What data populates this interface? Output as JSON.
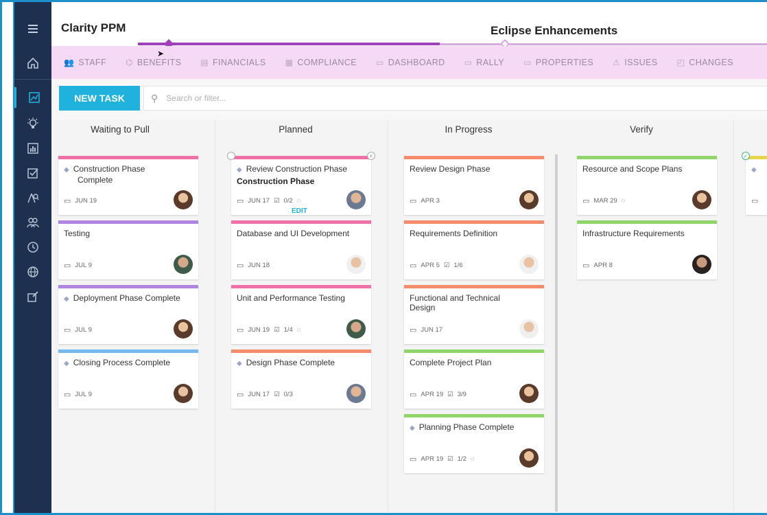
{
  "app": {
    "title": "Clarity PPM",
    "project_title": "Eclipse Enhancements"
  },
  "sidebar": {
    "items": [
      {
        "icon": "menu-icon"
      },
      {
        "icon": "home-icon"
      },
      {
        "icon": "chart-icon"
      },
      {
        "icon": "lightbulb-icon"
      },
      {
        "icon": "bar-chart-icon"
      },
      {
        "icon": "checkbox-icon"
      },
      {
        "icon": "person-search-icon"
      },
      {
        "icon": "users-icon"
      },
      {
        "icon": "clock-icon"
      },
      {
        "icon": "globe-icon"
      },
      {
        "icon": "edit-box-icon"
      }
    ]
  },
  "tabs": [
    {
      "label": "STAFF"
    },
    {
      "label": "BENEFITS"
    },
    {
      "label": "FINANCIALS"
    },
    {
      "label": "COMPLIANCE"
    },
    {
      "label": "DASHBOARD"
    },
    {
      "label": "RALLY"
    },
    {
      "label": "PROPERTIES"
    },
    {
      "label": "ISSUES"
    },
    {
      "label": "CHANGES"
    }
  ],
  "toolbar": {
    "new_task_label": "NEW TASK",
    "search_placeholder": "Search or filter..."
  },
  "columns": [
    {
      "title": "Waiting to Pull",
      "cards": [
        {
          "title": "Construction Phase Complete",
          "date": "JUN 19",
          "milestone": true,
          "stripe": "#f070a8",
          "avatar": "woman"
        },
        {
          "title": "Testing",
          "date": "JUL 9",
          "milestone": false,
          "stripe": "#b085e0",
          "avatar": "man"
        },
        {
          "title": "Deployment Phase Complete",
          "date": "JUL 9",
          "milestone": true,
          "stripe": "#b085e0",
          "avatar": "woman"
        },
        {
          "title": "Closing Process Complete",
          "date": "JUL 9",
          "milestone": true,
          "stripe": "#74b8ee",
          "avatar": "woman"
        }
      ]
    },
    {
      "title": "Planned",
      "cards": [
        {
          "title": "Review Construction Phase",
          "subtitle": "Construction Phase",
          "date": "JUN 17",
          "checks": "0/2",
          "comment": true,
          "edit": "EDIT",
          "milestone": true,
          "stripe": "#f070a8",
          "avatar": "glasses"
        },
        {
          "title": "Database and UI Development",
          "date": "JUN 18",
          "stripe": "#f070a8",
          "avatar": "white"
        },
        {
          "title": "Unit and Performance Testing",
          "date": "JUN 19",
          "checks": "1/4",
          "comment": true,
          "stripe": "#f070a8",
          "avatar": "man"
        },
        {
          "title": "Design Phase Complete",
          "date": "JUN 17",
          "checks": "0/3",
          "milestone": true,
          "stripe": "#f48c6c",
          "avatar": "glasses"
        }
      ]
    },
    {
      "title": "In Progress",
      "cards": [
        {
          "title": "Review Design Phase",
          "date": "APR 3",
          "stripe": "#f48c6c",
          "avatar": "woman"
        },
        {
          "title": "Requirements Definition",
          "date": "APR 5",
          "checks": "1/6",
          "stripe": "#f48c6c",
          "avatar": "white"
        },
        {
          "title": "Functional and Technical Design",
          "date": "JUN 17",
          "stripe": "#f48c6c",
          "avatar": "white"
        },
        {
          "title": "Complete Project Plan",
          "date": "APR 19",
          "checks": "3/9",
          "stripe": "#8fd56a",
          "avatar": "woman"
        },
        {
          "title": "Planning Phase Complete",
          "date": "APR 19",
          "checks": "1/2",
          "comment": true,
          "milestone": true,
          "stripe": "#8fd56a",
          "avatar": "woman"
        }
      ]
    },
    {
      "title": "Verify",
      "cards": [
        {
          "title": "Resource and Scope Plans",
          "date": "MAR 29",
          "comment": true,
          "stripe": "#8fd56a",
          "avatar": "woman"
        },
        {
          "title": "Infrastructure Requirements",
          "date": "APR 8",
          "stripe": "#8fd56a",
          "avatar": "dark"
        }
      ]
    }
  ],
  "colors": {
    "sidebar_bg": "#1d3050",
    "accent": "#1fb2dc",
    "tab_bg": "#f6d9f4",
    "progress": "#a040b8"
  }
}
